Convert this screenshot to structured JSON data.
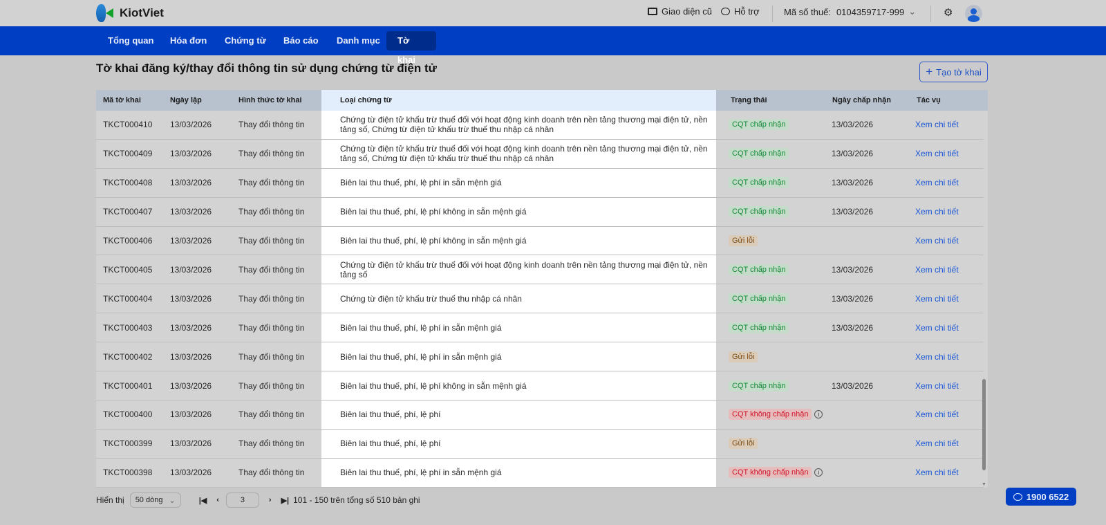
{
  "brand": "KiotViet",
  "topbar": {
    "old_ui": "Giao diện cũ",
    "support": "Hỗ trợ",
    "tax_label": "Mã số thuế:",
    "tax_value": "0104359717-999"
  },
  "nav": [
    "Tổng quan",
    "Hóa đơn",
    "Chứng từ",
    "Báo cáo",
    "Danh mục",
    "Tờ khai"
  ],
  "page_title": "Tờ khai đăng ký/thay đổi thông tin sử dụng chứng từ điện tử",
  "create_button": "Tạo tờ khai",
  "columns": [
    "Mã tờ khai",
    "Ngày lập",
    "Hình thức tờ khai",
    "Loại chứng từ",
    "Trạng thái",
    "Ngày chấp nhận",
    "Tác vụ"
  ],
  "rows": [
    {
      "id": "TKCT000410",
      "date": "13/03/2026",
      "form": "Thay đổi thông tin",
      "type": "Chứng từ điện tử khấu trừ thuế đối với hoạt động kinh doanh trên nền tảng thương mại điện tử, nền tảng số, Chứng từ điện tử khấu trừ thuế thu nhập cá nhân",
      "status": "CQT chấp nhận",
      "status_kind": "ok",
      "accepted": "13/03/2026",
      "action": "Xem chi tiết"
    },
    {
      "id": "TKCT000409",
      "date": "13/03/2026",
      "form": "Thay đổi thông tin",
      "type": "Chứng từ điện tử khấu trừ thuế đối với hoạt động kinh doanh trên nền tảng thương mại điện tử, nền tảng số, Chứng từ điện tử khấu trừ thuế thu nhập cá nhân",
      "status": "CQT chấp nhận",
      "status_kind": "ok",
      "accepted": "13/03/2026",
      "action": "Xem chi tiết"
    },
    {
      "id": "TKCT000408",
      "date": "13/03/2026",
      "form": "Thay đổi thông tin",
      "type": "Biên lai thu thuế, phí, lệ phí in sẵn mệnh giá",
      "status": "CQT chấp nhận",
      "status_kind": "ok",
      "accepted": "13/03/2026",
      "action": "Xem chi tiết"
    },
    {
      "id": "TKCT000407",
      "date": "13/03/2026",
      "form": "Thay đổi thông tin",
      "type": "Biên lai thu thuế, phí, lệ phí không in sẵn mệnh giá",
      "status": "CQT chấp nhận",
      "status_kind": "ok",
      "accepted": "13/03/2026",
      "action": "Xem chi tiết"
    },
    {
      "id": "TKCT000406",
      "date": "13/03/2026",
      "form": "Thay đổi thông tin",
      "type": "Biên lai thu thuế, phí, lệ phí không in sẵn mệnh giá",
      "status": "Gửi lỗi",
      "status_kind": "err",
      "accepted": "",
      "action": "Xem chi tiết"
    },
    {
      "id": "TKCT000405",
      "date": "13/03/2026",
      "form": "Thay đổi thông tin",
      "type": "Chứng từ điện tử khấu trừ thuế đối với hoạt động kinh doanh trên nền tảng thương mại điện tử, nền tảng số",
      "status": "CQT chấp nhận",
      "status_kind": "ok",
      "accepted": "13/03/2026",
      "action": "Xem chi tiết"
    },
    {
      "id": "TKCT000404",
      "date": "13/03/2026",
      "form": "Thay đổi thông tin",
      "type": "Chứng từ điện tử khấu trừ thuế thu nhập cá nhân",
      "status": "CQT chấp nhận",
      "status_kind": "ok",
      "accepted": "13/03/2026",
      "action": "Xem chi tiết"
    },
    {
      "id": "TKCT000403",
      "date": "13/03/2026",
      "form": "Thay đổi thông tin",
      "type": "Biên lai thu thuế, phí, lệ phí in sẵn mệnh giá",
      "status": "CQT chấp nhận",
      "status_kind": "ok",
      "accepted": "13/03/2026",
      "action": "Xem chi tiết"
    },
    {
      "id": "TKCT000402",
      "date": "13/03/2026",
      "form": "Thay đổi thông tin",
      "type": "Biên lai thu thuế, phí, lệ phí in sẵn mệnh giá",
      "status": "Gửi lỗi",
      "status_kind": "err",
      "accepted": "",
      "action": "Xem chi tiết"
    },
    {
      "id": "TKCT000401",
      "date": "13/03/2026",
      "form": "Thay đổi thông tin",
      "type": "Biên lai thu thuế, phí, lệ phí không in sẵn mệnh giá",
      "status": "CQT chấp nhận",
      "status_kind": "ok",
      "accepted": "13/03/2026",
      "action": "Xem chi tiết"
    },
    {
      "id": "TKCT000400",
      "date": "13/03/2026",
      "form": "Thay đổi thông tin",
      "type": "Biên lai thu thuế, phí, lệ phí",
      "status": "CQT không chấp nhận",
      "status_kind": "no",
      "accepted": "",
      "action": "Xem chi tiết"
    },
    {
      "id": "TKCT000399",
      "date": "13/03/2026",
      "form": "Thay đổi thông tin",
      "type": "Biên lai thu thuế, phí, lệ phí",
      "status": "Gửi lỗi",
      "status_kind": "err",
      "accepted": "",
      "action": "Xem chi tiết"
    },
    {
      "id": "TKCT000398",
      "date": "13/03/2026",
      "form": "Thay đổi thông tin",
      "type": "Biên lai thu thuế, phí, lệ phí in sẵn mệnh giá",
      "status": "CQT không chấp nhận",
      "status_kind": "no",
      "accepted": "",
      "action": "Xem chi tiết"
    }
  ],
  "footer": {
    "show_label": "Hiển thị",
    "page_size": "50 dòng",
    "page": "3",
    "range": "101 - 150 trên tổng số 510 bản ghi"
  },
  "hotline": "1900 6522"
}
